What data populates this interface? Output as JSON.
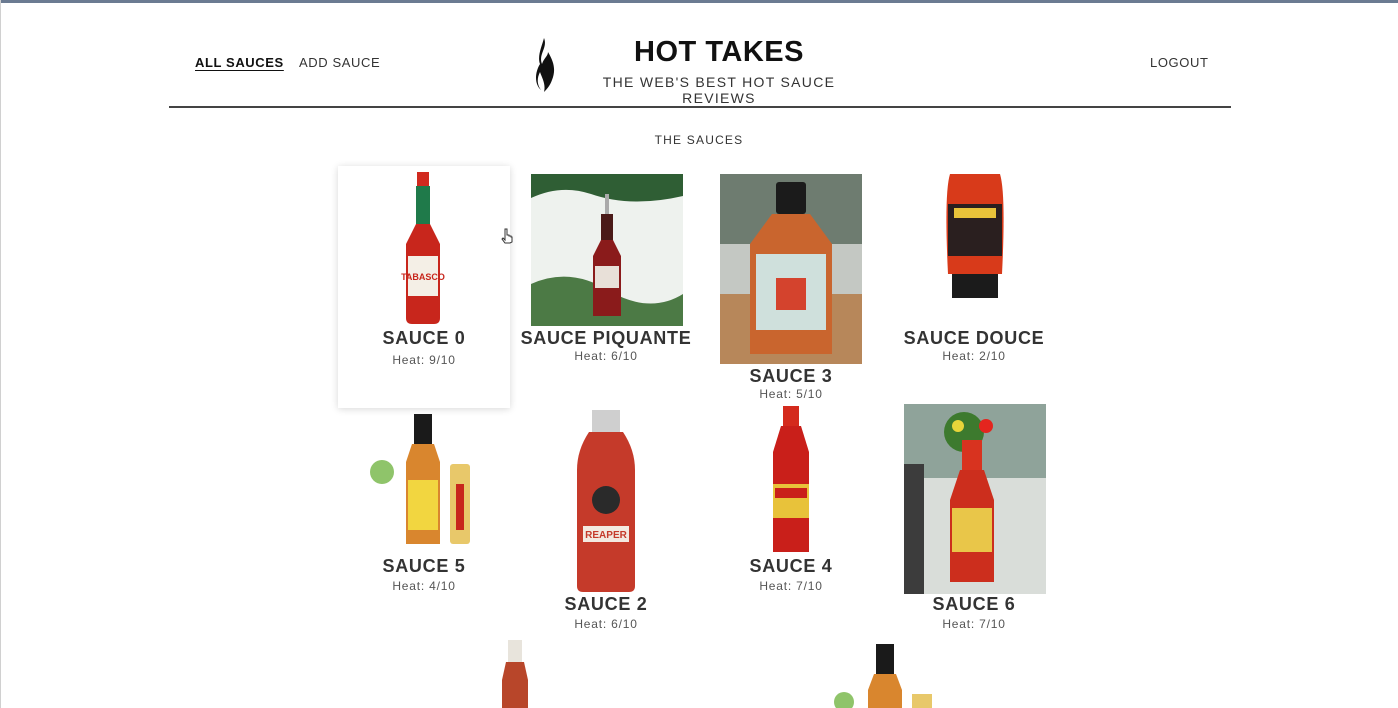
{
  "nav": {
    "all_sauces": "ALL SAUCES",
    "add_sauce": "ADD SAUCE",
    "logout": "LOGOUT"
  },
  "header": {
    "title": "HOT TAKES",
    "subtitle": "THE WEB'S BEST HOT SAUCE REVIEWS",
    "logo_icon": "flame-icon"
  },
  "section_title": "THE SAUCES",
  "sauces": [
    {
      "name": "SAUCE 0",
      "heat": "Heat: 9/10",
      "image": "tabasco-bottle"
    },
    {
      "name": "SAUCE PIQUANTE",
      "heat": "Heat: 6/10",
      "image": "ornament-bottle"
    },
    {
      "name": "SAUCE 3",
      "heat": "Heat: 5/10",
      "image": "hot-sauce-bottle"
    },
    {
      "name": "SAUCE DOUCE",
      "heat": "Heat: 2/10",
      "image": "squeeze-bottle"
    },
    {
      "name": "SAUCE 5",
      "heat": "Heat: 4/10",
      "image": "yellow-label-bottle"
    },
    {
      "name": "SAUCE 2",
      "heat": "Heat: 6/10",
      "image": "reaper-bottle"
    },
    {
      "name": "SAUCE 4",
      "heat": "Heat: 7/10",
      "image": "red-bottle"
    },
    {
      "name": "SAUCE 6",
      "heat": "Heat: 7/10",
      "image": "valentina-bottle"
    }
  ],
  "colors": {
    "accent": "#6b7b92",
    "text": "#333333",
    "sauce_red": "#c8261c"
  }
}
